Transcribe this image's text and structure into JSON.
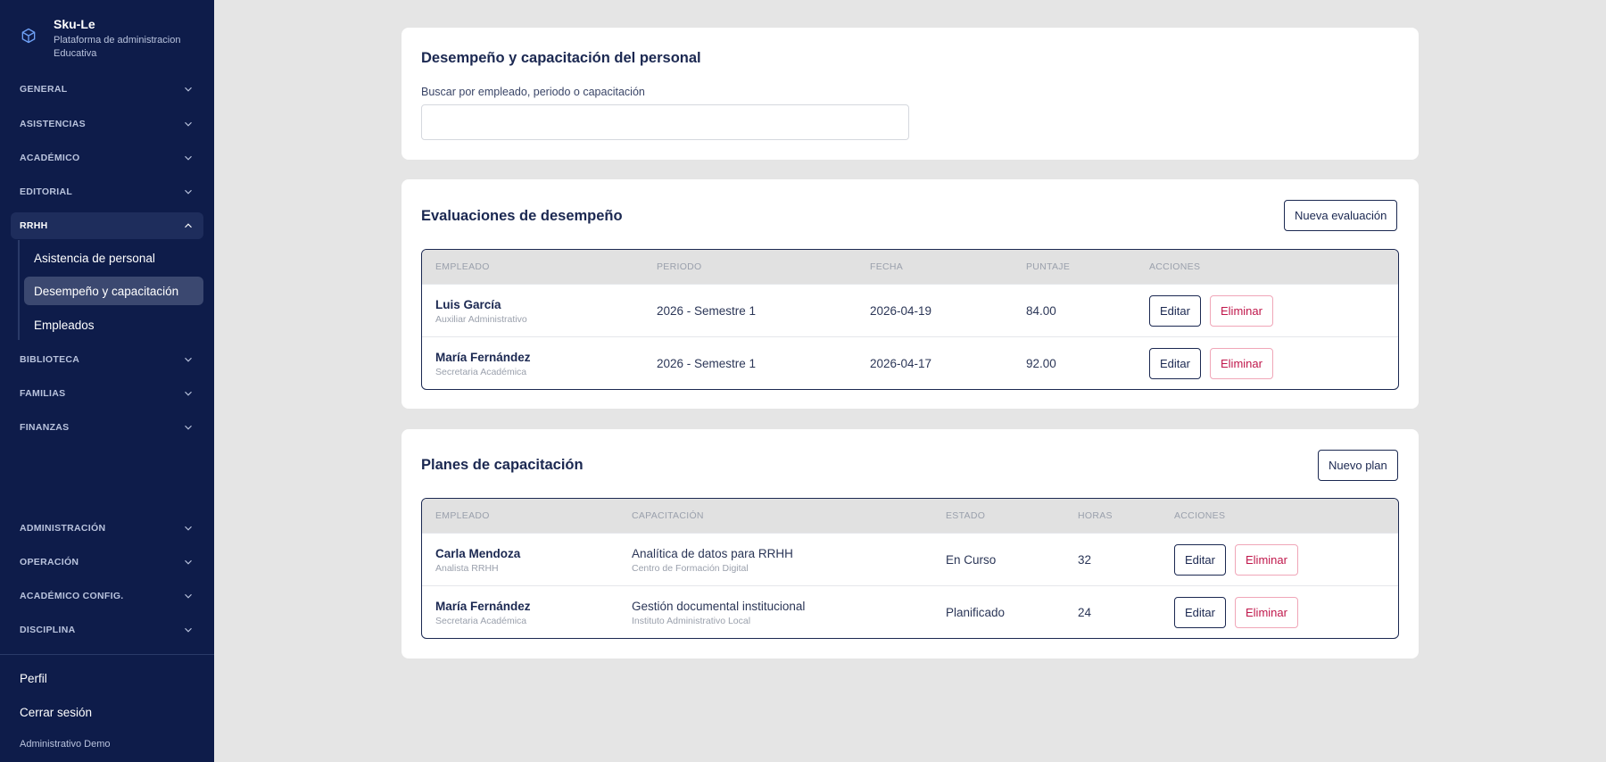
{
  "brand": {
    "name": "Sku-Le",
    "subtitle_line1": "Plataforma de administracion",
    "subtitle_line2": "Educativa"
  },
  "sidebar": {
    "sections": [
      "GENERAL",
      "ASISTENCIAS",
      "ACADÉMICO",
      "EDITORIAL",
      "RRHH",
      "BIBLIOTECA",
      "FAMILIAS",
      "FINANZAS",
      "ADMINISTRACIÓN",
      "OPERACIÓN",
      "ACADÉMICO CONFIG.",
      "DISCIPLINA"
    ],
    "rrhh_items": [
      "Asistencia de personal",
      "Desempeño y capacitación",
      "Empleados"
    ],
    "profile": "Perfil",
    "logout": "Cerrar sesión",
    "user": "Administrativo Demo"
  },
  "search_card": {
    "title": "Desempeño y capacitación del personal",
    "label": "Buscar por empleado, periodo o capacitación",
    "value": ""
  },
  "evaluations": {
    "title": "Evaluaciones de desempeño",
    "new_button": "Nueva evaluación",
    "headers": [
      "EMPLEADO",
      "PERIODO",
      "FECHA",
      "PUNTAJE",
      "ACCIONES"
    ],
    "rows": [
      {
        "name": "Luis García",
        "role": "Auxiliar Administrativo",
        "period": "2026 - Semestre 1",
        "date": "2026-04-19",
        "score": "84.00"
      },
      {
        "name": "María Fernández",
        "role": "Secretaria Académica",
        "period": "2026 - Semestre 1",
        "date": "2026-04-17",
        "score": "92.00"
      }
    ]
  },
  "plans": {
    "title": "Planes de capacitación",
    "new_button": "Nuevo plan",
    "headers": [
      "EMPLEADO",
      "CAPACITACIÓN",
      "ESTADO",
      "HORAS",
      "ACCIONES"
    ],
    "rows": [
      {
        "name": "Carla Mendoza",
        "role": "Analista RRHH",
        "course": "Analítica de datos para RRHH",
        "provider": "Centro de Formación Digital",
        "status": "En Curso",
        "hours": "32"
      },
      {
        "name": "María Fernández",
        "role": "Secretaria Académica",
        "course": "Gestión documental institucional",
        "provider": "Instituto Administrativo Local",
        "status": "Planificado",
        "hours": "24"
      }
    ]
  },
  "actions": {
    "edit": "Editar",
    "delete": "Eliminar"
  },
  "colors": {
    "sidebar_bg": "#0e1c4a",
    "active_item_bg": "#3b4870",
    "danger": "#c0174b",
    "page_bg": "#e5e5e5"
  }
}
